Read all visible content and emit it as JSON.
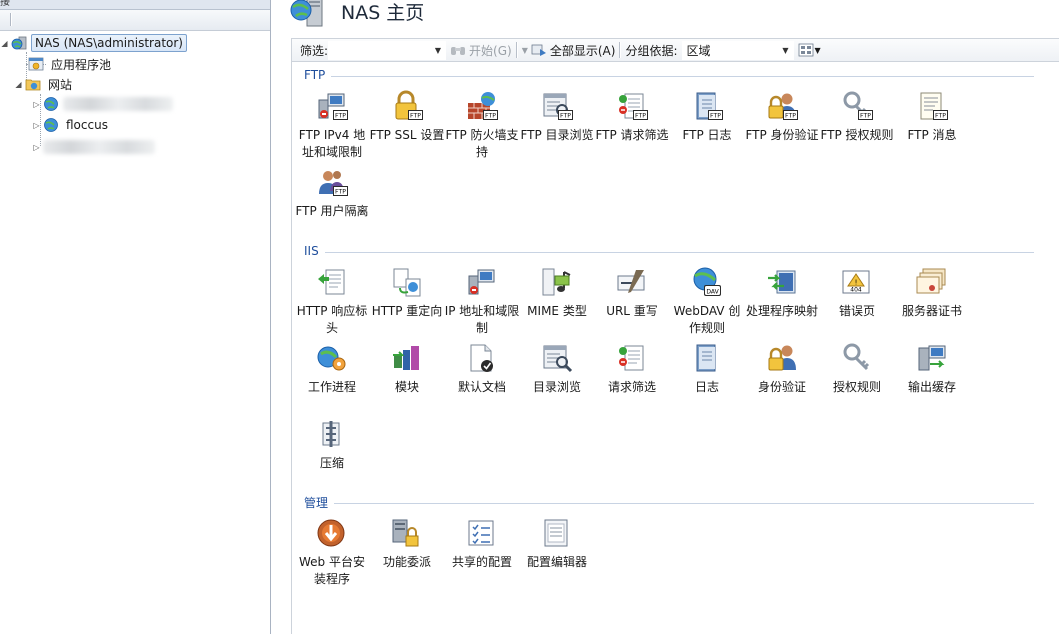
{
  "left_pane": {
    "header_fragment": "接",
    "tree": {
      "root": "NAS (NAS\\administrator)",
      "app_pools": "应用程序池",
      "sites": "网站",
      "site_2": "floccus"
    }
  },
  "header": {
    "title": "NAS 主页"
  },
  "filterbar": {
    "filter_label": "筛选:",
    "filter_value": "",
    "start_label": "开始(G)",
    "show_all_label": "全部显示(A)",
    "group_by_label": "分组依据:",
    "group_by_value": "区域"
  },
  "groups": {
    "ftp": {
      "title": "FTP",
      "items": [
        {
          "label": "FTP IPv4 地址和域限制",
          "icon": "ftp-ip-restrictions-icon"
        },
        {
          "label": "FTP SSL 设置",
          "icon": "ftp-ssl-icon"
        },
        {
          "label": "FTP 防火墙支持",
          "icon": "ftp-firewall-icon"
        },
        {
          "label": "FTP 目录浏览",
          "icon": "ftp-directory-browsing-icon"
        },
        {
          "label": "FTP 请求筛选",
          "icon": "ftp-request-filtering-icon"
        },
        {
          "label": "FTP 日志",
          "icon": "ftp-logging-icon"
        },
        {
          "label": "FTP 身份验证",
          "icon": "ftp-authentication-icon"
        },
        {
          "label": "FTP 授权规则",
          "icon": "ftp-authorization-icon"
        },
        {
          "label": "FTP 消息",
          "icon": "ftp-messages-icon"
        },
        {
          "label": "FTP 用户隔离",
          "icon": "ftp-user-isolation-icon"
        }
      ]
    },
    "iis": {
      "title": "IIS",
      "items": [
        {
          "label": "HTTP 响应标头",
          "icon": "http-response-headers-icon"
        },
        {
          "label": "HTTP 重定向",
          "icon": "http-redirect-icon"
        },
        {
          "label": "IP 地址和域限制",
          "icon": "ip-restrictions-icon"
        },
        {
          "label": "MIME 类型",
          "icon": "mime-types-icon"
        },
        {
          "label": "URL 重写",
          "icon": "url-rewrite-icon"
        },
        {
          "label": "WebDAV 创作规则",
          "icon": "webdav-icon"
        },
        {
          "label": "处理程序映射",
          "icon": "handler-mappings-icon"
        },
        {
          "label": "错误页",
          "icon": "error-pages-icon"
        },
        {
          "label": "服务器证书",
          "icon": "server-certificates-icon"
        },
        {
          "label": "工作进程",
          "icon": "worker-processes-icon"
        },
        {
          "label": "模块",
          "icon": "modules-icon"
        },
        {
          "label": "默认文档",
          "icon": "default-document-icon"
        },
        {
          "label": "目录浏览",
          "icon": "directory-browsing-icon"
        },
        {
          "label": "请求筛选",
          "icon": "request-filtering-icon"
        },
        {
          "label": "日志",
          "icon": "logging-icon"
        },
        {
          "label": "身份验证",
          "icon": "authentication-icon"
        },
        {
          "label": "授权规则",
          "icon": "authorization-icon"
        },
        {
          "label": "输出缓存",
          "icon": "output-caching-icon"
        },
        {
          "label": "压缩",
          "icon": "compression-icon"
        }
      ]
    },
    "management": {
      "title": "管理",
      "items": [
        {
          "label": "Web 平台安装程序",
          "icon": "web-platform-installer-icon"
        },
        {
          "label": "功能委派",
          "icon": "feature-delegation-icon"
        },
        {
          "label": "共享的配置",
          "icon": "shared-configuration-icon"
        },
        {
          "label": "配置编辑器",
          "icon": "configuration-editor-icon"
        }
      ]
    }
  },
  "colors": {
    "group_title": "#1f4e9c",
    "ftp_badge": "#2b2b2b",
    "selection_border": "#7da2ce"
  }
}
